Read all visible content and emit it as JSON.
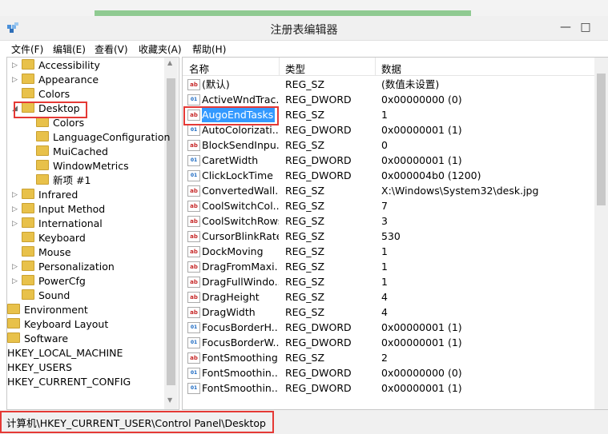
{
  "window": {
    "title": "注册表编辑器",
    "minimize_glyph": "—",
    "maximize_glyph": "□"
  },
  "menu": [
    "文件(F)",
    "编辑(E)",
    "查看(V)",
    "收藏夹(A)",
    "帮助(H)"
  ],
  "tree": [
    {
      "label": "Accessibility",
      "expand": "▷",
      "indent": 1
    },
    {
      "label": "Appearance",
      "expand": "▷",
      "indent": 1
    },
    {
      "label": "Colors",
      "expand": "",
      "indent": 1
    },
    {
      "label": "Desktop",
      "expand": "◢",
      "indent": 1,
      "highlighted": true
    },
    {
      "label": "Colors",
      "expand": "",
      "indent": 2
    },
    {
      "label": "LanguageConfiguration",
      "expand": "",
      "indent": 2
    },
    {
      "label": "MuiCached",
      "expand": "",
      "indent": 2
    },
    {
      "label": "WindowMetrics",
      "expand": "",
      "indent": 2
    },
    {
      "label": "新项 #1",
      "expand": "",
      "indent": 2
    },
    {
      "label": "Infrared",
      "expand": "▷",
      "indent": 1
    },
    {
      "label": "Input Method",
      "expand": "▷",
      "indent": 1
    },
    {
      "label": "International",
      "expand": "▷",
      "indent": 1
    },
    {
      "label": "Keyboard",
      "expand": "",
      "indent": 1
    },
    {
      "label": "Mouse",
      "expand": "",
      "indent": 1
    },
    {
      "label": "Personalization",
      "expand": "▷",
      "indent": 1
    },
    {
      "label": "PowerCfg",
      "expand": "▷",
      "indent": 1
    },
    {
      "label": "Sound",
      "expand": "",
      "indent": 1
    },
    {
      "label": "Environment",
      "expand": "",
      "indent": 0
    },
    {
      "label": "Keyboard Layout",
      "expand": "",
      "indent": 0
    },
    {
      "label": "Software",
      "expand": "",
      "indent": 0
    },
    {
      "label": "HKEY_LOCAL_MACHINE",
      "expand": "",
      "indent": -1
    },
    {
      "label": "HKEY_USERS",
      "expand": "",
      "indent": -1
    },
    {
      "label": "HKEY_CURRENT_CONFIG",
      "expand": "",
      "indent": -1
    }
  ],
  "columns": {
    "name": "名称",
    "type": "类型",
    "data": "数据"
  },
  "values": [
    {
      "icon": "ab",
      "name": "(默认)",
      "type": "REG_SZ",
      "data": "(数值未设置)"
    },
    {
      "icon": "01",
      "name": "ActiveWndTrac...",
      "type": "REG_DWORD",
      "data": "0x00000000 (0)"
    },
    {
      "icon": "ab",
      "name": "AugoEndTasks",
      "type": "REG_SZ",
      "data": "1",
      "selected": true
    },
    {
      "icon": "01",
      "name": "AutoColorizati...",
      "type": "REG_DWORD",
      "data": "0x00000001 (1)"
    },
    {
      "icon": "ab",
      "name": "BlockSendInpu...",
      "type": "REG_SZ",
      "data": "0"
    },
    {
      "icon": "01",
      "name": "CaretWidth",
      "type": "REG_DWORD",
      "data": "0x00000001 (1)"
    },
    {
      "icon": "01",
      "name": "ClickLockTime",
      "type": "REG_DWORD",
      "data": "0x000004b0 (1200)"
    },
    {
      "icon": "ab",
      "name": "ConvertedWall...",
      "type": "REG_SZ",
      "data": "X:\\Windows\\System32\\desk.jpg"
    },
    {
      "icon": "ab",
      "name": "CoolSwitchCol...",
      "type": "REG_SZ",
      "data": "7"
    },
    {
      "icon": "ab",
      "name": "CoolSwitchRows",
      "type": "REG_SZ",
      "data": "3"
    },
    {
      "icon": "ab",
      "name": "CursorBlinkRate",
      "type": "REG_SZ",
      "data": "530"
    },
    {
      "icon": "ab",
      "name": "DockMoving",
      "type": "REG_SZ",
      "data": "1"
    },
    {
      "icon": "ab",
      "name": "DragFromMaxi...",
      "type": "REG_SZ",
      "data": "1"
    },
    {
      "icon": "ab",
      "name": "DragFullWindo...",
      "type": "REG_SZ",
      "data": "1"
    },
    {
      "icon": "ab",
      "name": "DragHeight",
      "type": "REG_SZ",
      "data": "4"
    },
    {
      "icon": "ab",
      "name": "DragWidth",
      "type": "REG_SZ",
      "data": "4"
    },
    {
      "icon": "01",
      "name": "FocusBorderH...",
      "type": "REG_DWORD",
      "data": "0x00000001 (1)"
    },
    {
      "icon": "01",
      "name": "FocusBorderW...",
      "type": "REG_DWORD",
      "data": "0x00000001 (1)"
    },
    {
      "icon": "ab",
      "name": "FontSmoothing",
      "type": "REG_SZ",
      "data": "2"
    },
    {
      "icon": "01",
      "name": "FontSmoothin...",
      "type": "REG_DWORD",
      "data": "0x00000000 (0)"
    },
    {
      "icon": "01",
      "name": "FontSmoothin...",
      "type": "REG_DWORD",
      "data": "0x00000001 (1)"
    }
  ],
  "status_path": "计算机\\HKEY_CURRENT_USER\\Control Panel\\Desktop"
}
